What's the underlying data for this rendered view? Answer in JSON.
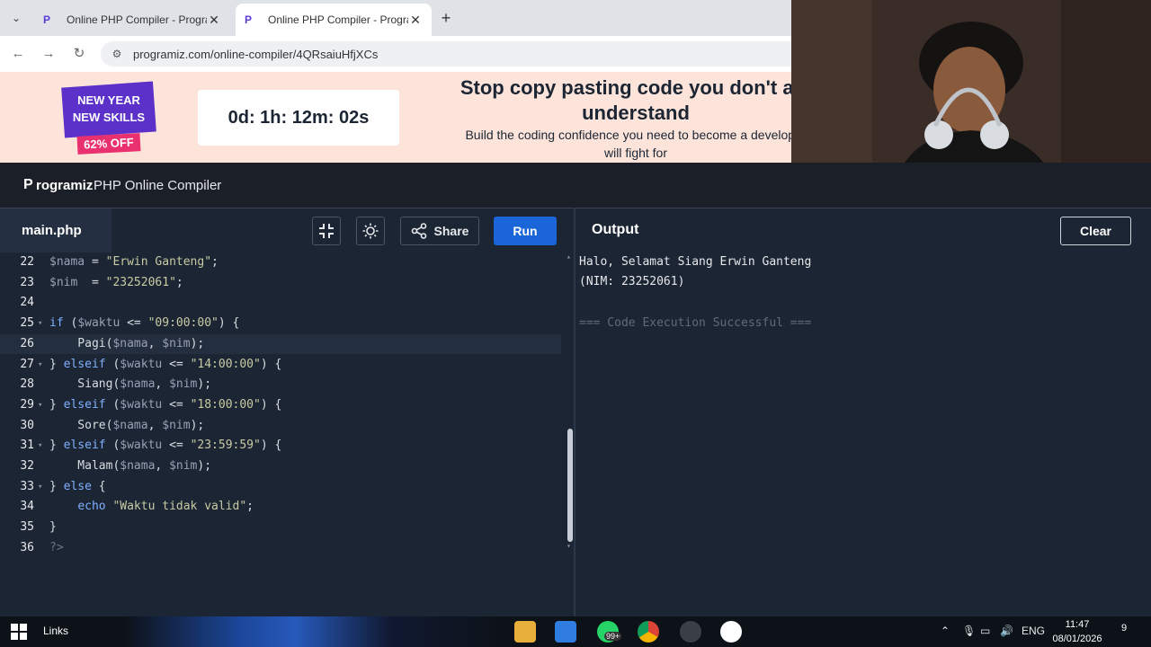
{
  "browser": {
    "tabs": [
      {
        "title": "Online PHP Compiler - Program",
        "active": false
      },
      {
        "title": "Online PHP Compiler - Program",
        "active": true
      }
    ],
    "url": "programiz.com/online-compiler/4QRsaiuHfjXCs"
  },
  "banner": {
    "promo_line1": "NEW YEAR",
    "promo_line2": "NEW SKILLS",
    "promo_discount": "62% OFF",
    "countdown": "0d: 1h: 12m: 02s",
    "headline_line1": "Stop copy pasting code you don't act",
    "headline_line2": "understand",
    "subtext_line1": "Build the coding confidence you need to become a developer",
    "subtext_line2": "will fight for"
  },
  "header": {
    "logo_mark": "P",
    "logo_text": "rogramiz",
    "app_title": "PHP Online Compiler"
  },
  "toolbar": {
    "file_name": "main.php",
    "share_label": "Share",
    "run_label": "Run",
    "output_label": "Output",
    "clear_label": "Clear"
  },
  "editor": {
    "lines": [
      {
        "num": "22",
        "fold": "",
        "text": "$nama = \"Erwin Ganteng\";"
      },
      {
        "num": "23",
        "fold": "",
        "text": "$nim  = \"23252061\";"
      },
      {
        "num": "24",
        "fold": "",
        "text": ""
      },
      {
        "num": "25",
        "fold": "▾",
        "text": "if ($waktu <= \"09:00:00\") {"
      },
      {
        "num": "26",
        "fold": "",
        "text": "    Pagi($nama, $nim);"
      },
      {
        "num": "27",
        "fold": "▾",
        "text": "} elseif ($waktu <= \"14:00:00\") {"
      },
      {
        "num": "28",
        "fold": "",
        "text": "    Siang($nama, $nim);"
      },
      {
        "num": "29",
        "fold": "▾",
        "text": "} elseif ($waktu <= \"18:00:00\") {"
      },
      {
        "num": "30",
        "fold": "",
        "text": "    Sore($nama, $nim);"
      },
      {
        "num": "31",
        "fold": "▾",
        "text": "} elseif ($waktu <= \"23:59:59\") {"
      },
      {
        "num": "32",
        "fold": "",
        "text": "    Malam($nama, $nim);"
      },
      {
        "num": "33",
        "fold": "▾",
        "text": "} else {"
      },
      {
        "num": "34",
        "fold": "",
        "text": "    echo \"Waktu tidak valid\";"
      },
      {
        "num": "35",
        "fold": "",
        "text": "}"
      },
      {
        "num": "36",
        "fold": "",
        "text": "?>"
      }
    ],
    "active_line": "26"
  },
  "output": {
    "lines": [
      "Halo, Selamat Siang Erwin Ganteng",
      "(NIM: 23252061)",
      "",
      "=== Code Execution Successful ==="
    ]
  },
  "taskbar": {
    "links_label": "Links",
    "whatsapp_badge": "99+",
    "language": "ENG",
    "time": "11:47",
    "date": "08/01/2026",
    "notification_count": "9"
  },
  "colors": {
    "run_button": "#1a66d9",
    "editor_bg": "#1c2533",
    "banner_bg": "#fde4da",
    "promo_purple": "#5b31c9"
  }
}
